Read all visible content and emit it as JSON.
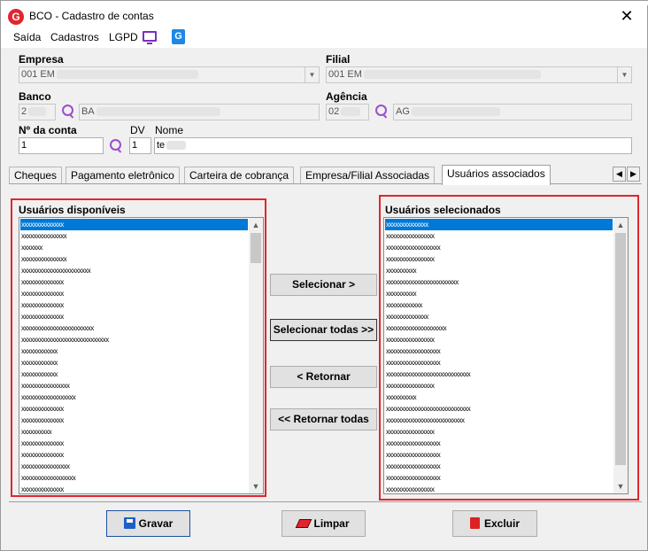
{
  "window": {
    "title": "BCO - Cadastro de contas",
    "close_glyph": "✕"
  },
  "menu": {
    "items": [
      "Saída",
      "Cadastros",
      "LGPD"
    ],
    "tv_icon": "tv-icon",
    "g_icon": "G"
  },
  "form": {
    "empresa": {
      "label": "Empresa",
      "value": "001 EM"
    },
    "filial": {
      "label": "Filial",
      "value": "001 EM"
    },
    "banco": {
      "label": "Banco",
      "code": "2",
      "name": "BA"
    },
    "agencia": {
      "label": "Agência",
      "code": "02",
      "name": "AG"
    },
    "conta": {
      "label": "Nº da conta",
      "value": "1"
    },
    "dv": {
      "label": "DV",
      "value": "1"
    },
    "nome": {
      "label": "Nome",
      "value": "te"
    }
  },
  "tabs": [
    "Cheques",
    "Pagamento eletrônico",
    "Carteira de cobrança",
    "Empresa/Filial Associadas",
    "Usuários associados"
  ],
  "active_tab": "Usuários associados",
  "available": {
    "title": "Usuários disponíveis",
    "items": [
      "xxxxxxxxxxxxxx",
      "xxxxxxxxxxxxxxx",
      "xxxxxxx",
      "xxxxxxxxxxxxxxx",
      "xxxxxxxxxxxxxxxxxxxxxxx",
      "xxxxxxxxxxxxxx",
      "xxxxxxxxxxxxxx",
      "xxxxxxxxxxxxxx",
      "xxxxxxxxxxxxxx",
      "xxxxxxxxxxxxxxxxxxxxxxxx",
      "xxxxxxxxxxxxxxxxxxxxxxxxxxxxx",
      "xxxxxxxxxxxx",
      "xxxxxxxxxxxx",
      "xxxxxxxxxxxx",
      "xxxxxxxxxxxxxxxx",
      "xxxxxxxxxxxxxxxxxx",
      "xxxxxxxxxxxxxx",
      "xxxxxxxxxxxxxx",
      "xxxxxxxxxx",
      "xxxxxxxxxxxxxx",
      "xxxxxxxxxxxxxx",
      "xxxxxxxxxxxxxxxx",
      "xxxxxxxxxxxxxxxxxx",
      "xxxxxxxxxxxxxx",
      "xxxxxxxxxxxxxxxxxx",
      "xxxxxxxxxxxxxx",
      "xxxxxxxxxxxxxx",
      "xxxxxxxxxxxxxxxx",
      "xxxxxxxxxxxxxxxx"
    ]
  },
  "selected": {
    "title": "Usuários selecionados",
    "items": [
      "xxxxxxxxxxxxxx",
      "xxxxxxxxxxxxxxxx",
      "xxxxxxxxxxxxxxxxxx",
      "xxxxxxxxxxxxxxxx",
      "xxxxxxxxxx",
      "xxxxxxxxxxxxxxxxxxxxxxxx",
      "xxxxxxxxxx",
      "xxxxxxxxxxxx",
      "xxxxxxxxxxxxxx",
      "xxxxxxxxxxxxxxxxxxxx",
      "xxxxxxxxxxxxxxxx",
      "xxxxxxxxxxxxxxxxxx",
      "xxxxxxxxxxxxxxxxxx",
      "xxxxxxxxxxxxxxxxxxxxxxxxxxxx",
      "xxxxxxxxxxxxxxxx",
      "xxxxxxxxxx",
      "xxxxxxxxxxxxxxxxxxxxxxxxxxxx",
      "xxxxxxxxxxxxxxxxxxxxxxxxxx",
      "xxxxxxxxxxxxxxxx",
      "xxxxxxxxxxxxxxxxxx",
      "xxxxxxxxxxxxxxxxxx",
      "xxxxxxxxxxxxxxxxxx",
      "xxxxxxxxxxxxxxxxxx",
      "xxxxxxxxxxxxxxxx"
    ]
  },
  "transfer": {
    "select": "Selecionar >",
    "select_all": "Selecionar todas >>",
    "back": "< Retornar",
    "back_all": "<< Retornar todas"
  },
  "footer": {
    "save": "Gravar",
    "clear": "Limpar",
    "delete": "Excluir"
  },
  "colors": {
    "accent_red": "#e0262d",
    "selection_blue": "#0078d7",
    "icon_purple": "#9c4dcc"
  }
}
